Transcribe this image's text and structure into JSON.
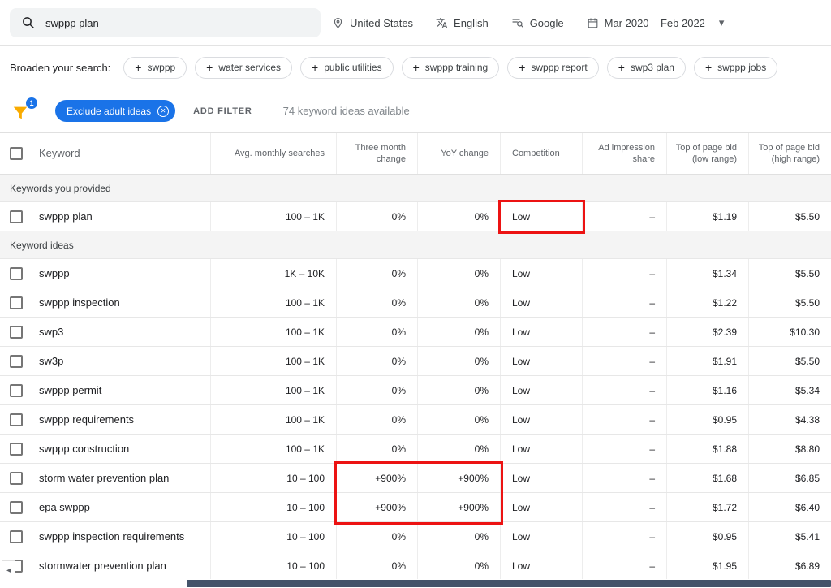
{
  "colors": {
    "accent": "#1a73e8",
    "annotation": "#ec1313",
    "funnel": "#f9ab00",
    "scroll-thumb": "#44546a"
  },
  "icons": {
    "plus": "+",
    "close": "✕",
    "caret": "▾",
    "scroll_left": "◂"
  },
  "topbar": {
    "search_value": "swppp plan",
    "location": "United States",
    "language": "English",
    "network": "Google",
    "date_range": "Mar 2020 – Feb 2022"
  },
  "broaden": {
    "label": "Broaden your search:",
    "chips": [
      "swppp",
      "water services",
      "public utilities",
      "swppp training",
      "swppp report",
      "swp3 plan",
      "swppp jobs"
    ]
  },
  "filterbar": {
    "filter_count": "1",
    "exclude_chip_label": "Exclude adult ideas",
    "add_filter_label": "ADD FILTER",
    "ideas_available": "74 keyword ideas available"
  },
  "table": {
    "headers": [
      "Keyword",
      "Avg. monthly searches",
      "Three month change",
      "YoY change",
      "Competition",
      "Ad impression share",
      "Top of page bid (low range)",
      "Top of page bid (high range)"
    ],
    "sections": [
      {
        "label": "Keywords you provided",
        "rows": [
          {
            "keyword": "swppp plan",
            "searches": "100 – 1K",
            "three_month": "0%",
            "yoy": "0%",
            "competition": "Low",
            "ad_share": "–",
            "low_bid": "$1.19",
            "high_bid": "$5.50"
          }
        ]
      },
      {
        "label": "Keyword ideas",
        "rows": [
          {
            "keyword": "swppp",
            "searches": "1K – 10K",
            "three_month": "0%",
            "yoy": "0%",
            "competition": "Low",
            "ad_share": "–",
            "low_bid": "$1.34",
            "high_bid": "$5.50"
          },
          {
            "keyword": "swppp inspection",
            "searches": "100 – 1K",
            "three_month": "0%",
            "yoy": "0%",
            "competition": "Low",
            "ad_share": "–",
            "low_bid": "$1.22",
            "high_bid": "$5.50"
          },
          {
            "keyword": "swp3",
            "searches": "100 – 1K",
            "three_month": "0%",
            "yoy": "0%",
            "competition": "Low",
            "ad_share": "–",
            "low_bid": "$2.39",
            "high_bid": "$10.30"
          },
          {
            "keyword": "sw3p",
            "searches": "100 – 1K",
            "three_month": "0%",
            "yoy": "0%",
            "competition": "Low",
            "ad_share": "–",
            "low_bid": "$1.91",
            "high_bid": "$5.50"
          },
          {
            "keyword": "swppp permit",
            "searches": "100 – 1K",
            "three_month": "0%",
            "yoy": "0%",
            "competition": "Low",
            "ad_share": "–",
            "low_bid": "$1.16",
            "high_bid": "$5.34"
          },
          {
            "keyword": "swppp requirements",
            "searches": "100 – 1K",
            "three_month": "0%",
            "yoy": "0%",
            "competition": "Low",
            "ad_share": "–",
            "low_bid": "$0.95",
            "high_bid": "$4.38"
          },
          {
            "keyword": "swppp construction",
            "searches": "100 – 1K",
            "three_month": "0%",
            "yoy": "0%",
            "competition": "Low",
            "ad_share": "–",
            "low_bid": "$1.88",
            "high_bid": "$8.80"
          },
          {
            "keyword": "storm water prevention plan",
            "searches": "10 – 100",
            "three_month": "+900%",
            "yoy": "+900%",
            "competition": "Low",
            "ad_share": "–",
            "low_bid": "$1.68",
            "high_bid": "$6.85"
          },
          {
            "keyword": "epa swppp",
            "searches": "10 – 100",
            "three_month": "+900%",
            "yoy": "+900%",
            "competition": "Low",
            "ad_share": "–",
            "low_bid": "$1.72",
            "high_bid": "$6.40"
          },
          {
            "keyword": "swppp inspection requirements",
            "searches": "10 – 100",
            "three_month": "0%",
            "yoy": "0%",
            "competition": "Low",
            "ad_share": "–",
            "low_bid": "$0.95",
            "high_bid": "$5.41"
          },
          {
            "keyword": "stormwater prevention plan",
            "searches": "10 – 100",
            "three_month": "0%",
            "yoy": "0%",
            "competition": "Low",
            "ad_share": "–",
            "low_bid": "$1.95",
            "high_bid": "$6.89"
          }
        ]
      }
    ]
  }
}
